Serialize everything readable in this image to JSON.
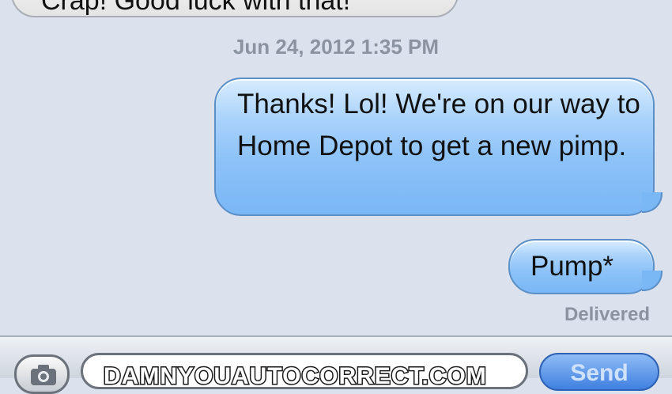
{
  "conversation": {
    "incoming_partial": "Crap! Good luck with that!",
    "timestamp": "Jun 24, 2012 1:35 PM",
    "messages": [
      {
        "text": "Thanks! Lol! We're on our way to Home Depot to get a new pimp."
      },
      {
        "text": "Pump*"
      }
    ],
    "status": "Delivered"
  },
  "compose": {
    "watermark": "DAMNYOUAUTOCORRECT.COM",
    "send_label": "Send",
    "camera_icon": "camera-icon"
  },
  "colors": {
    "background": "#dbe2ed",
    "outgoing_bubble": "#8cc2f8",
    "incoming_bubble": "#ececec",
    "meta_text": "#8b93a0",
    "send_button": "#3f80e0"
  }
}
